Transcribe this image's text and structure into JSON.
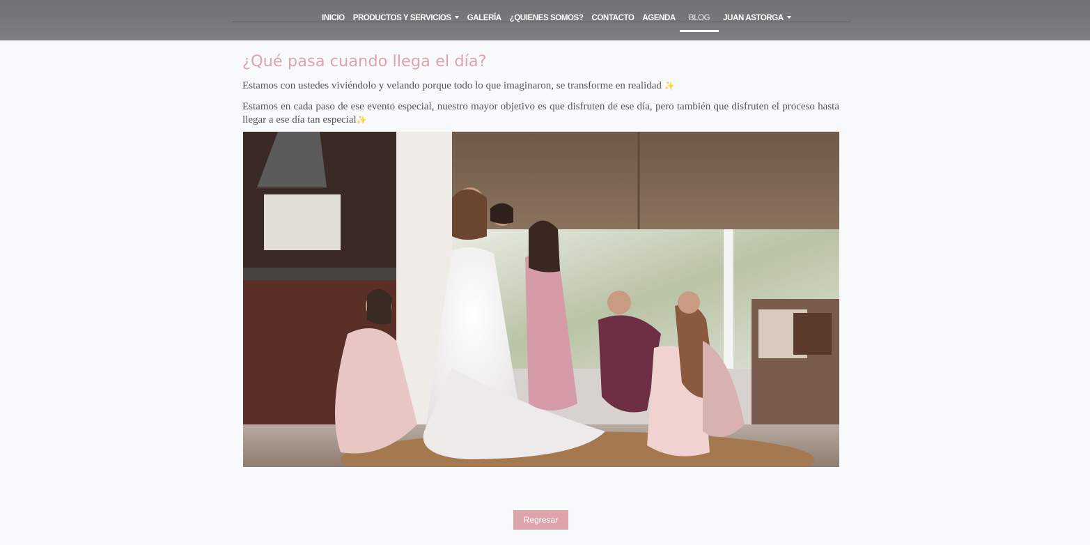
{
  "nav": {
    "items": [
      {
        "label": "INICIO",
        "dropdown": false,
        "active": false
      },
      {
        "label": "PRODUCTOS Y SERVICIOS",
        "dropdown": true,
        "active": false
      },
      {
        "label": "GALERÍA",
        "dropdown": false,
        "active": false
      },
      {
        "label": "¿QUIENES SOMOS?",
        "dropdown": false,
        "active": false
      },
      {
        "label": "CONTACTO",
        "dropdown": false,
        "active": false
      },
      {
        "label": "AGENDA",
        "dropdown": false,
        "active": false
      },
      {
        "label": "BLOG",
        "dropdown": false,
        "active": true
      },
      {
        "label": "JUAN ASTORGA",
        "dropdown": true,
        "active": false
      }
    ]
  },
  "post": {
    "title": "¿Qué pasa cuando llega el día?",
    "paragraph_1": "Estamos con ustedes viviéndolo y velando porque todo lo que imaginaron, se transforme en realidad",
    "paragraph_2": "Estamos en cada paso de ese evento especial, nuestro mayor objetivo es que disfruten de ese día, pero también que disfruten el proceso hasta llegar a ese día tan especial",
    "sparkle": "✨",
    "image_icon": "photo-bride-with-bridesmaids"
  },
  "actions": {
    "back_label": "Regresar"
  },
  "colors": {
    "accent": "#dea4ac",
    "navbar": "#767779",
    "background": "#f8f9fb",
    "body_text": "#555555"
  }
}
